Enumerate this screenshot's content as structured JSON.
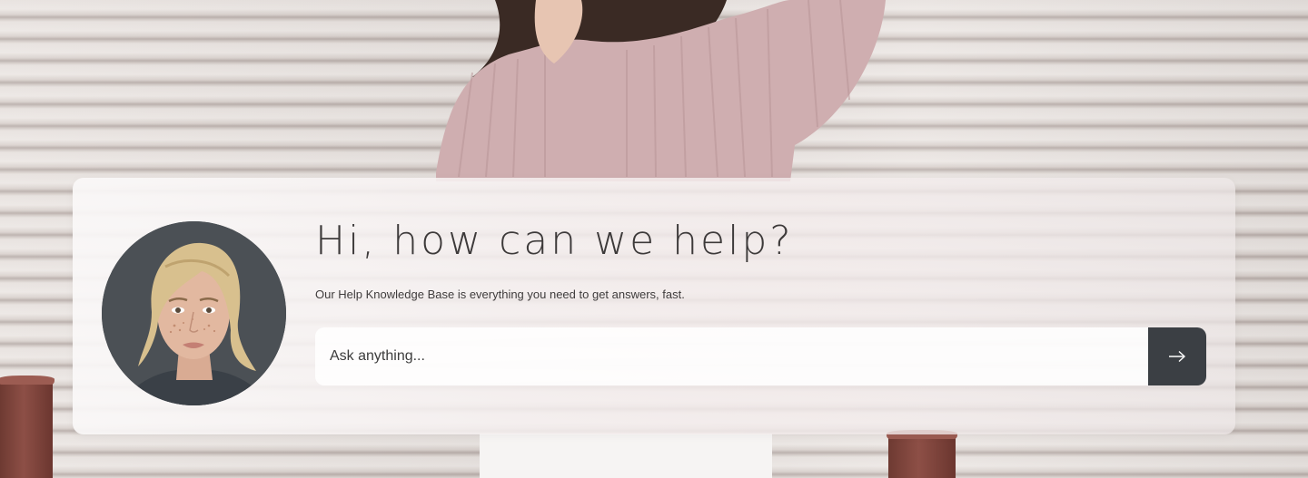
{
  "hero": {
    "headline": "Hi, how can we help?",
    "subline": "Our Help Knowledge Base is everything you need to get answers, fast."
  },
  "search": {
    "placeholder": "Ask anything...",
    "submit_icon": "arrow-right-icon"
  },
  "avatar": {
    "icon": "support-agent-avatar"
  },
  "colors": {
    "button_bg": "#3b3f44",
    "headline_text": "#3d3a3a",
    "sweater": "#cfaeb0",
    "background_shutter": "#e7e1de"
  }
}
